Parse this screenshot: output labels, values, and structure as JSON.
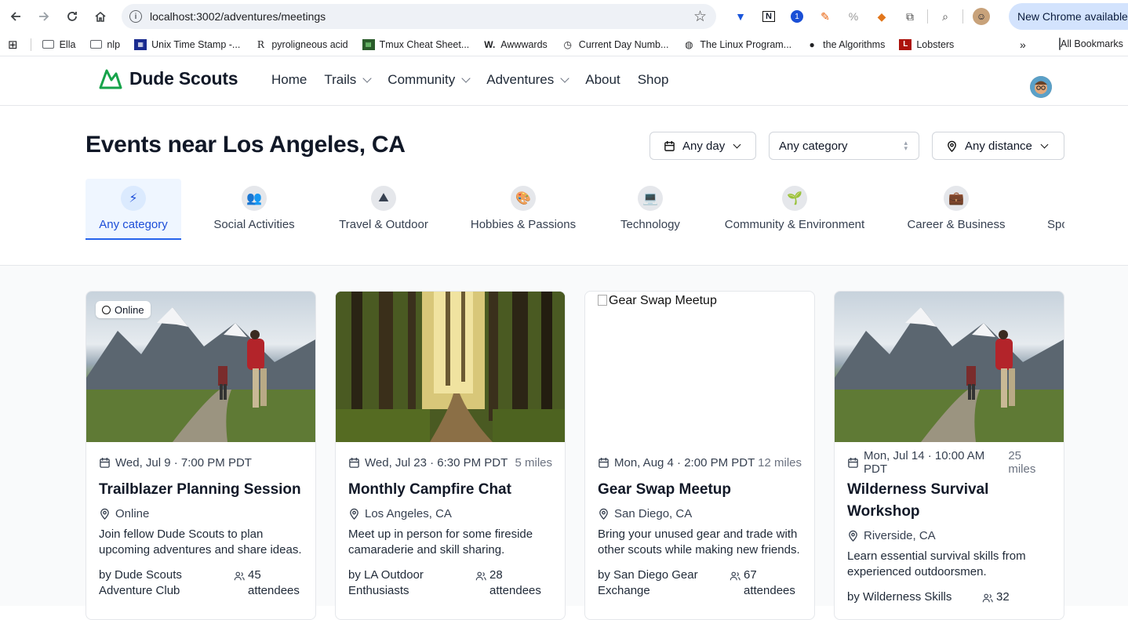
{
  "browser": {
    "url": "localhost:3002/adventures/meetings",
    "update_label": "New Chrome available",
    "bookmarks": [
      "Ella",
      "nlp",
      "Unix Time Stamp -...",
      "pyroligneous acid",
      "Tmux Cheat Sheet...",
      "Awwwards",
      "Current Day Numb...",
      "The Linux Program...",
      "the Algorithms",
      "Lobsters"
    ],
    "all_bookmarks": "All Bookmarks"
  },
  "site": {
    "brand": "Dude Scouts",
    "brand_color": "#16a34a",
    "nav": [
      "Home",
      "Trails",
      "Community",
      "Adventures",
      "About",
      "Shop"
    ]
  },
  "page": {
    "title": "Events near Los Angeles, CA",
    "filter_day": "Any day",
    "filter_category": "Any category",
    "filter_distance": "Any distance"
  },
  "categories": [
    {
      "label": "Any category",
      "icon": "⚡",
      "active": true
    },
    {
      "label": "Social Activities",
      "icon": "👥"
    },
    {
      "label": "Travel & Outdoor",
      "icon": "⛰"
    },
    {
      "label": "Hobbies & Passions",
      "icon": "🎨"
    },
    {
      "label": "Technology",
      "icon": "💻"
    },
    {
      "label": "Community & Environment",
      "icon": "🌱"
    },
    {
      "label": "Career & Business",
      "icon": "💼"
    },
    {
      "label": "Spo",
      "icon": ""
    }
  ],
  "events": [
    {
      "badge": "Online",
      "date": "Wed, Jul 9 · 7:00 PM PDT",
      "distance": "",
      "title": "Trailblazer Planning Session",
      "location": "Online",
      "description": "Join fellow Dude Scouts to plan upcoming adventures and share ideas.",
      "organizer": "by Dude Scouts Adventure Club",
      "attendees": "45 attendees",
      "image_alt": ""
    },
    {
      "badge": "",
      "date": "Wed, Jul 23 · 6:30 PM PDT",
      "distance": "5 miles",
      "title": "Monthly Campfire Chat",
      "location": "Los Angeles, CA",
      "description": "Meet up in person for some fireside camaraderie and skill sharing.",
      "organizer": "by LA Outdoor Enthusiasts",
      "attendees": "28 attendees",
      "image_alt": ""
    },
    {
      "badge": "",
      "date": "Mon, Aug 4 · 2:00 PM PDT",
      "distance": "12 miles",
      "title": "Gear Swap Meetup",
      "location": "San Diego, CA",
      "description": "Bring your unused gear and trade with other scouts while making new friends.",
      "organizer": "by San Diego Gear Exchange",
      "attendees": "67 attendees",
      "image_alt": "Gear Swap Meetup"
    },
    {
      "badge": "",
      "date": "Mon, Jul 14 · 10:00 AM PDT",
      "distance": "25 miles",
      "title": "Wilderness Survival Workshop",
      "location": "Riverside, CA",
      "description": "Learn essential survival skills from experienced outdoorsmen.",
      "organizer": "by Wilderness Skills",
      "attendees": "32",
      "image_alt": ""
    }
  ]
}
